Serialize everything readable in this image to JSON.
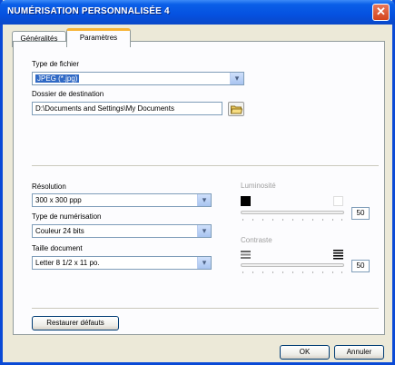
{
  "window": {
    "title": "NUMÉRISATION PERSONNALISÉE 4",
    "close_glyph": "✕"
  },
  "tabs": [
    {
      "label": "Généralités"
    },
    {
      "label": "Paramètres"
    }
  ],
  "file_type": {
    "label": "Type de fichier",
    "value": "JPEG (*.jpg)"
  },
  "destination": {
    "label": "Dossier de destination",
    "value": "D:\\Documents and Settings\\My Documents"
  },
  "resolution": {
    "label": "Résolution",
    "value": "300 x 300 ppp"
  },
  "scan_type": {
    "label": "Type de numérisation",
    "value": "Couleur 24 bits"
  },
  "doc_size": {
    "label": "Taille document",
    "value": "Letter 8 1/2 x 11 po."
  },
  "brightness": {
    "label": "Luminosité",
    "value": "50"
  },
  "contrast": {
    "label": "Contraste",
    "value": "50"
  },
  "buttons": {
    "restore": "Restaurer défauts",
    "ok": "OK",
    "cancel": "Annuler"
  },
  "arrow_glyph": "▾"
}
